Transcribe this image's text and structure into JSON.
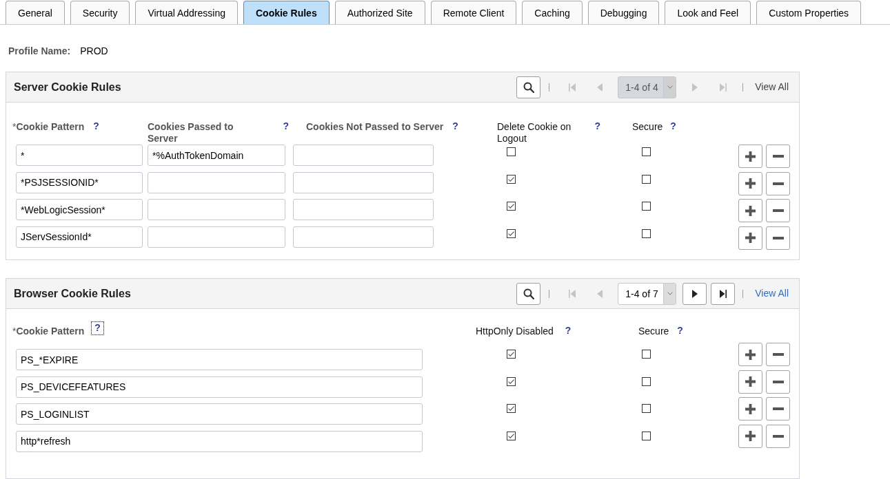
{
  "tabs": [
    {
      "label": "General",
      "selected": false
    },
    {
      "label": "Security",
      "selected": false
    },
    {
      "label": "Virtual Addressing",
      "selected": false
    },
    {
      "label": "Cookie Rules",
      "selected": true
    },
    {
      "label": "Authorized Site",
      "selected": false
    },
    {
      "label": "Remote Client",
      "selected": false
    },
    {
      "label": "Caching",
      "selected": false
    },
    {
      "label": "Debugging",
      "selected": false
    },
    {
      "label": "Look and Feel",
      "selected": false
    },
    {
      "label": "Custom Properties",
      "selected": false
    }
  ],
  "profile": {
    "label": "Profile Name:",
    "value": "PROD"
  },
  "sections": [
    {
      "kind": "server",
      "title": "Server Cookie Rules",
      "pager": {
        "first": {
          "disabled": true
        },
        "previous": {
          "disabled": true
        },
        "page_select": {
          "value": "1-4 of 4",
          "disabled": true
        },
        "next": {
          "disabled": true
        },
        "last": {
          "disabled": true
        },
        "view_all": {
          "label": "View All",
          "disabled": true
        }
      },
      "columns": [
        {
          "kind": "text",
          "required_mark": "*",
          "label": "Cookie Pattern",
          "help": "?",
          "focused": false
        },
        {
          "kind": "text",
          "label": "Cookies Passed to Server",
          "help": "?",
          "focused": false
        },
        {
          "kind": "text",
          "label": "Cookies Not Passed to Server",
          "help": "?",
          "focused": false
        },
        {
          "kind": "checkbox",
          "label": "Delete Cookie on Logout",
          "help": "?",
          "focused": false
        },
        {
          "kind": "checkbox",
          "label": "Secure",
          "help": "?",
          "focused": false
        }
      ],
      "rows": [
        {
          "cells": [
            {
              "value": "*"
            },
            {
              "value": "*%AuthTokenDomain"
            },
            {},
            {
              "checked": false
            },
            {
              "checked": false
            }
          ]
        },
        {
          "cells": [
            {
              "value": "*PSJSESSIONID*"
            },
            {},
            {},
            {
              "checked": true
            },
            {
              "checked": false
            }
          ]
        },
        {
          "cells": [
            {
              "value": "*WebLogicSession*"
            },
            {},
            {},
            {
              "checked": true
            },
            {
              "checked": false
            }
          ]
        },
        {
          "cells": [
            {
              "value": "JServSessionId*"
            },
            {},
            {},
            {
              "checked": true
            },
            {
              "checked": false
            }
          ]
        }
      ]
    },
    {
      "kind": "browser",
      "title": "Browser Cookie Rules",
      "pager": {
        "first": {
          "disabled": true
        },
        "previous": {
          "disabled": true
        },
        "page_select": {
          "value": "1-4 of 7",
          "disabled": false
        },
        "next": {
          "disabled": false
        },
        "last": {
          "disabled": false
        },
        "view_all": {
          "label": "View All",
          "disabled": false
        }
      },
      "columns": [
        {
          "kind": "text",
          "required_mark": "*",
          "label": "Cookie Pattern",
          "help": "?",
          "focused": true
        },
        {
          "kind": "checkbox",
          "label": "HttpOnly Disabled",
          "help": "?",
          "focused": false
        },
        {
          "kind": "checkbox",
          "label": "Secure",
          "help": "?",
          "focused": false
        }
      ],
      "rows": [
        {
          "cells": [
            {
              "value": "PS_*EXPIRE"
            },
            {
              "checked": true
            },
            {
              "checked": false
            }
          ]
        },
        {
          "cells": [
            {
              "value": "PS_DEVICEFEATURES"
            },
            {
              "checked": true
            },
            {
              "checked": false
            }
          ]
        },
        {
          "cells": [
            {
              "value": "PS_LOGINLIST"
            },
            {
              "checked": true
            },
            {
              "checked": false
            }
          ]
        },
        {
          "cells": [
            {
              "value": "http*refresh"
            },
            {
              "checked": true
            },
            {
              "checked": false
            }
          ]
        }
      ]
    }
  ]
}
